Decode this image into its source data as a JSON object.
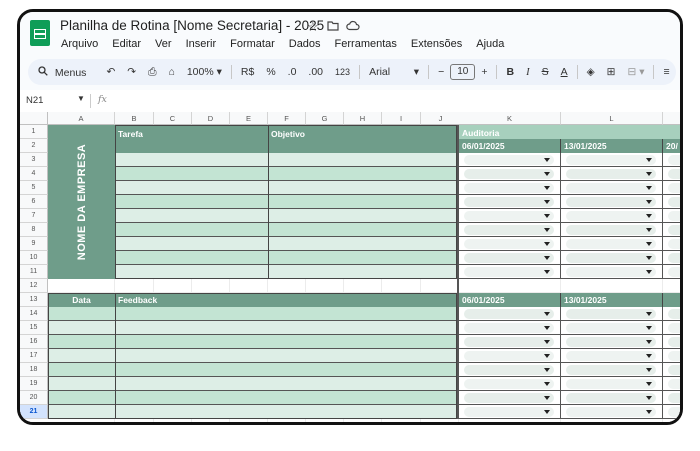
{
  "doc": {
    "title": "Planilha de Rotina [Nome Secretaria] - 2025"
  },
  "menu": [
    "Arquivo",
    "Editar",
    "Ver",
    "Inserir",
    "Formatar",
    "Dados",
    "Ferramentas",
    "Extensões",
    "Ajuda"
  ],
  "toolbar": {
    "search_label": "Menus",
    "zoom": "100%",
    "currency": "R$",
    "percent": "%",
    "dec_decrease": ".0",
    "dec_increase": ".00",
    "number_format": "123",
    "font": "Arial",
    "font_size": "10",
    "bold": "B",
    "italic": "I",
    "text_color": "A"
  },
  "formula_bar": {
    "cell_ref": "N21",
    "fx": "fx"
  },
  "columns": [
    "A",
    "B",
    "C",
    "D",
    "E",
    "F",
    "G",
    "H",
    "I",
    "J",
    "K",
    "L"
  ],
  "rows": [
    "1",
    "2",
    "3",
    "4",
    "5",
    "6",
    "7",
    "8",
    "9",
    "10",
    "11",
    "12",
    "13",
    "14",
    "15",
    "16",
    "17",
    "18",
    "19",
    "20",
    "21"
  ],
  "sheet": {
    "company": "NOME DA EMPRESA",
    "tarefa": "Tarefa",
    "objetivo": "Objetivo",
    "auditoria": "Auditoria",
    "date1": "06/01/2025",
    "date2": "13/01/2025",
    "date3_partial": "20/",
    "data": "Data",
    "feedback": "Feedback"
  },
  "colors": {
    "header_green": "#6f9d8a",
    "band_light": "#ddeee6",
    "band_alt": "#c3e4d3",
    "sheets_green": "#0f9d58"
  }
}
